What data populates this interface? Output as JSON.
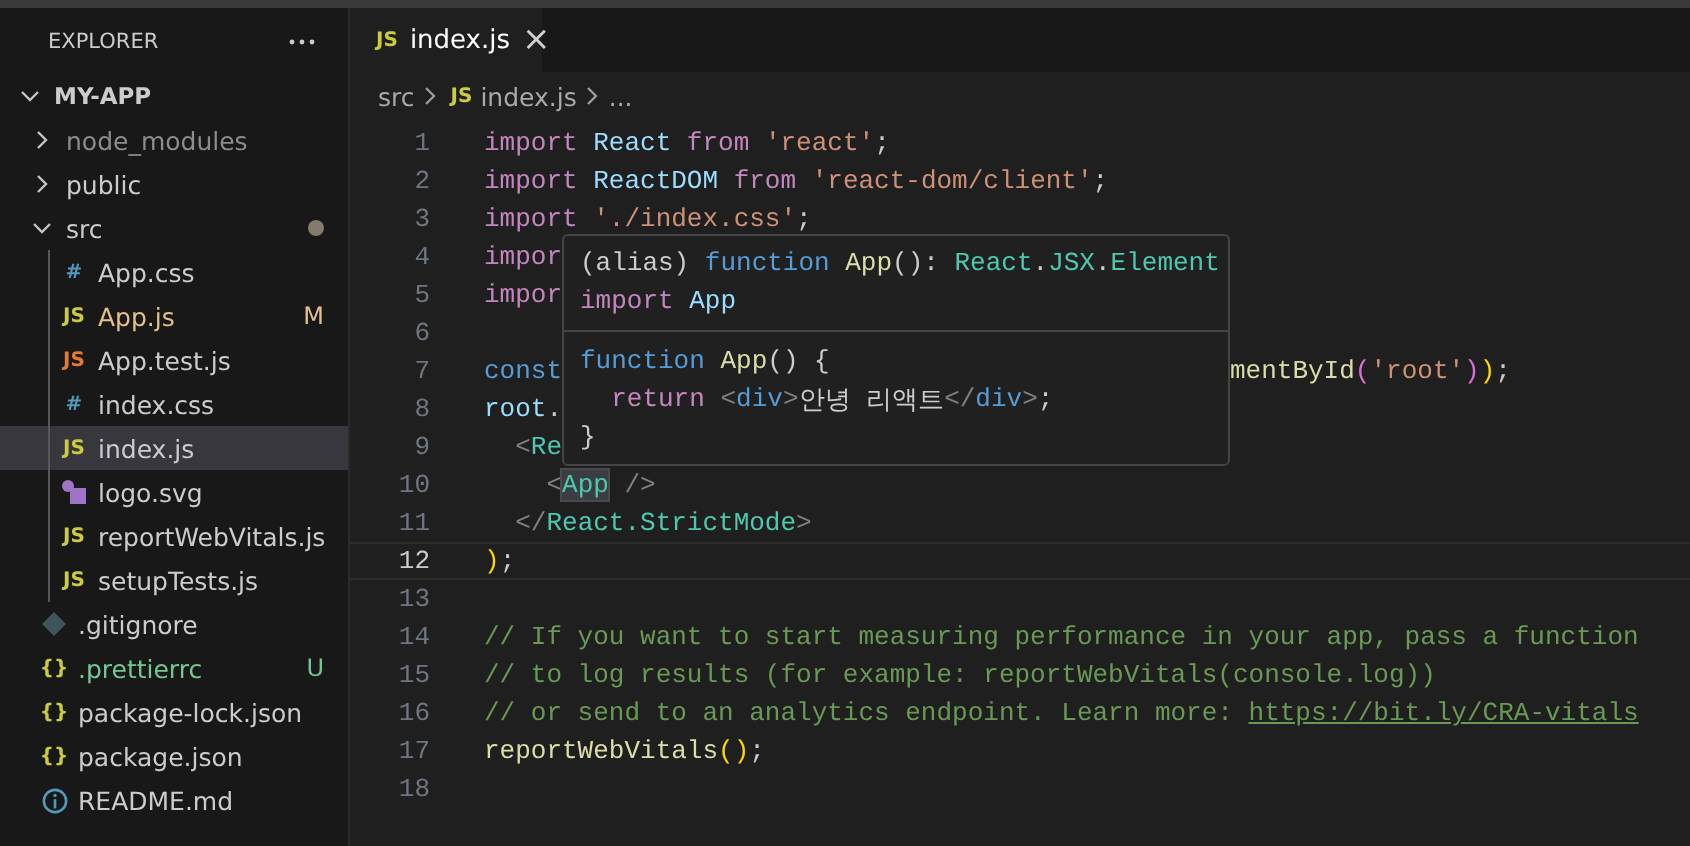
{
  "sidebar": {
    "title": "EXPLORER",
    "tree": [
      {
        "label": "MY-APP",
        "kind": "root",
        "expanded": true,
        "children": [
          {
            "label": "node_modules",
            "kind": "folder",
            "expanded": false,
            "color": "#8c8c8c"
          },
          {
            "label": "public",
            "kind": "folder",
            "expanded": false
          },
          {
            "label": "src",
            "kind": "folder",
            "expanded": true,
            "changed_dot": true,
            "children": [
              {
                "label": "App.css",
                "kind": "css",
                "glyph": "#",
                "selected": false
              },
              {
                "label": "App.js",
                "kind": "js",
                "glyph": "JS",
                "color": "#e2c08d",
                "badge": "M",
                "selected": false
              },
              {
                "label": "App.test.js",
                "kind": "test",
                "glyph": "JS",
                "selected": false
              },
              {
                "label": "index.css",
                "kind": "css",
                "glyph": "#",
                "selected": false
              },
              {
                "label": "index.js",
                "kind": "js",
                "glyph": "JS",
                "selected": true
              },
              {
                "label": "logo.svg",
                "kind": "svg",
                "selected": false
              },
              {
                "label": "reportWebVitals.js",
                "kind": "js",
                "glyph": "JS",
                "selected": false
              },
              {
                "label": "setupTests.js",
                "kind": "js",
                "glyph": "JS",
                "selected": false
              }
            ]
          },
          {
            "label": ".gitignore",
            "kind": "git",
            "selected": false
          },
          {
            "label": ".prettierrc",
            "kind": "json",
            "glyph": "{}",
            "color": "#73c991",
            "badge": "U",
            "selected": false
          },
          {
            "label": "package-lock.json",
            "kind": "json",
            "glyph": "{}",
            "selected": false
          },
          {
            "label": "package.json",
            "kind": "json",
            "glyph": "{}",
            "selected": false
          },
          {
            "label": "README.md",
            "kind": "info",
            "selected": false
          }
        ]
      }
    ]
  },
  "tabs": [
    {
      "label": "index.js",
      "glyph": "JS",
      "close": "×",
      "selected": true
    }
  ],
  "breadcrumbs": [
    {
      "label": "src"
    },
    {
      "label": "index.js",
      "glyph": "JS"
    },
    {
      "label": "..."
    }
  ],
  "editor": {
    "lines": [
      {
        "n": "1",
        "current": false,
        "tokens": [
          {
            "kind": "kw",
            "text": "import"
          },
          {
            "kind": "var",
            "text": " React"
          },
          {
            "kind": "kw",
            "text": " from"
          },
          {
            "kind": "str",
            "text": " 'react'"
          },
          {
            "kind": "p",
            "text": ";"
          }
        ]
      },
      {
        "n": "2",
        "current": false,
        "tokens": [
          {
            "kind": "kw",
            "text": "import"
          },
          {
            "kind": "var",
            "text": " ReactDOM"
          },
          {
            "kind": "kw",
            "text": " from"
          },
          {
            "kind": "str",
            "text": " 'react-dom/client'"
          },
          {
            "kind": "p",
            "text": ";"
          }
        ]
      },
      {
        "n": "3",
        "current": false,
        "tokens": [
          {
            "kind": "kw",
            "text": "import"
          },
          {
            "kind": "str",
            "text": " './index.css'"
          },
          {
            "kind": "p",
            "text": ";"
          }
        ]
      },
      {
        "n": "4",
        "current": false,
        "tokens": [
          {
            "kind": "kw",
            "text": "impor"
          }
        ]
      },
      {
        "n": "5",
        "current": false,
        "tokens": [
          {
            "kind": "kw",
            "text": "impor"
          }
        ]
      },
      {
        "n": "6",
        "current": false
      },
      {
        "n": "7",
        "current": false,
        "tokens": [
          {
            "kind": "decl",
            "text": "const"
          }
        ],
        "after_popup": [
          {
            "kind": "fn",
            "text": "mentById"
          },
          {
            "kind": "b2",
            "text": "("
          },
          {
            "kind": "str",
            "text": "'root'"
          },
          {
            "kind": "b2",
            "text": ")"
          },
          {
            "kind": "b1",
            "text": ")"
          },
          {
            "kind": "p",
            "text": ";"
          }
        ]
      },
      {
        "n": "8",
        "current": false,
        "tokens": [
          {
            "kind": "var",
            "text": "root"
          },
          {
            "kind": "p",
            "text": "."
          }
        ]
      },
      {
        "n": "9",
        "current": false,
        "tokens": [
          {
            "kind": "tag",
            "text": "  <"
          },
          {
            "kind": "cls",
            "text": "Re"
          }
        ]
      },
      {
        "n": "10",
        "current": false,
        "tokens": [
          {
            "kind": "tag",
            "text": "    <"
          },
          {
            "kind": "cls",
            "text": "App",
            "highlighted": true
          },
          {
            "kind": "tag",
            "text": " />"
          }
        ]
      },
      {
        "n": "11",
        "current": false,
        "tokens": [
          {
            "kind": "tag",
            "text": "  </"
          },
          {
            "kind": "cls",
            "text": "React.StrictMode"
          },
          {
            "kind": "tag",
            "text": ">"
          }
        ]
      },
      {
        "n": "12",
        "current": true,
        "tokens": [
          {
            "kind": "b1",
            "text": ")"
          },
          {
            "kind": "p",
            "text": ";"
          }
        ]
      },
      {
        "n": "13",
        "current": false
      },
      {
        "n": "14",
        "current": false,
        "tokens": [
          {
            "kind": "com",
            "text": "// If you want to start measuring performance in your app, pass a function"
          }
        ]
      },
      {
        "n": "15",
        "current": false,
        "tokens": [
          {
            "kind": "com",
            "text": "// to log results (for example: reportWebVitals(console.log))"
          }
        ]
      },
      {
        "n": "16",
        "current": false,
        "tokens": [
          {
            "kind": "com",
            "text": "// or send to an analytics endpoint. Learn more: "
          },
          {
            "kind": "link",
            "text": "https://bit.ly/CRA-vitals"
          }
        ]
      },
      {
        "n": "17",
        "current": false,
        "tokens": [
          {
            "kind": "fn",
            "text": "reportWebVitals"
          },
          {
            "kind": "b1",
            "text": "()"
          },
          {
            "kind": "p",
            "text": ";"
          }
        ]
      },
      {
        "n": "18",
        "current": false
      }
    ]
  },
  "hover_popup": {
    "signature": [
      [
        {
          "kind": "p",
          "text": "(alias)"
        },
        {
          "kind": "decl",
          "text": " function"
        },
        {
          "kind": "fn",
          "text": " App"
        },
        {
          "kind": "p",
          "text": "():"
        },
        {
          "kind": "cls",
          "text": " React"
        },
        {
          "kind": "p",
          "text": "."
        },
        {
          "kind": "cls",
          "text": "JSX"
        },
        {
          "kind": "p",
          "text": "."
        },
        {
          "kind": "cls",
          "text": "Element"
        }
      ],
      [
        {
          "kind": "kw",
          "text": "import"
        },
        {
          "kind": "var",
          "text": " App"
        }
      ]
    ],
    "body": [
      [
        {
          "kind": "decl",
          "text": "function"
        },
        {
          "kind": "fn",
          "text": " App"
        },
        {
          "kind": "p",
          "text": "() {"
        }
      ],
      [
        {
          "kind": "kw",
          "text": "  return"
        },
        {
          "kind": "tag",
          "text": " <"
        },
        {
          "kind": "decl",
          "text": "div"
        },
        {
          "kind": "tag",
          "text": ">"
        },
        {
          "kind": "p",
          "text": "안녕 리액트"
        },
        {
          "kind": "tag",
          "text": "</"
        },
        {
          "kind": "decl",
          "text": "div"
        },
        {
          "kind": "tag",
          "text": ">"
        },
        {
          "kind": "p",
          "text": ";"
        }
      ],
      [
        {
          "kind": "p",
          "text": "}"
        }
      ]
    ]
  }
}
